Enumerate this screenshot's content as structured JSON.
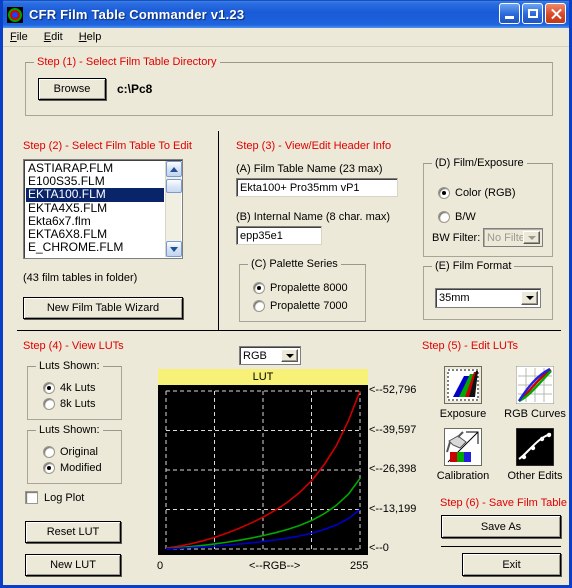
{
  "window": {
    "title": "CFR Film Table Commander v1.23",
    "app_icon": "rgb-ring-icon",
    "minimize": "minimize-icon",
    "maximize": "maximize-icon",
    "close": "close-icon"
  },
  "menu": [
    {
      "label": "File",
      "accel": "F"
    },
    {
      "label": "Edit",
      "accel": "E"
    },
    {
      "label": "Help",
      "accel": "H"
    }
  ],
  "step1": {
    "legend": "Step (1) - Select Film Table Directory",
    "browse_label": "Browse",
    "directory": "c:\\Pc8"
  },
  "step2": {
    "title": "Step (2) - Select Film Table To Edit",
    "items": [
      "ASTIARAP.FLM",
      "E100S35.FLM",
      "EKTA100.FLM",
      "EKTA4X5.FLM",
      "Ekta6x7.flm",
      "EKTA6X8.FLM",
      "E_CHROME.FLM"
    ],
    "selected_index": 2,
    "count_text": "(43 film tables in folder)",
    "wizard_label": "New Film Table Wizard"
  },
  "step3": {
    "title": "Step (3) - View/Edit Header Info",
    "a_label": "(A) Film Table Name (23 max)",
    "a_value": "Ekta100+ Pro35mm vP1",
    "b_label": "(B) Internal Name (8 char. max)",
    "b_value": "epp35e1",
    "c_legend": "(C) Palette Series",
    "c_options": [
      "Propalette 8000",
      "Propalette 7000"
    ],
    "c_selected": 0,
    "d_legend": "(D) Film/Exposure",
    "d_options": [
      "Color (RGB)",
      "B/W"
    ],
    "d_selected": 0,
    "bw_filter_label": "BW Filter:",
    "bw_filter_value": "No Filter",
    "e_legend": "(E) Film Format",
    "e_value": "35mm"
  },
  "step4": {
    "title": "Step (4) - View LUTs",
    "g1_legend": "Luts Shown:",
    "g1_options": [
      "4k Luts",
      "8k Luts"
    ],
    "g1_selected": 0,
    "g2_legend": "Luts Shown:",
    "g2_options": [
      "Original",
      "Modified"
    ],
    "g2_selected": 1,
    "log_plot_label": "Log Plot",
    "log_plot_checked": false,
    "reset_label": "Reset LUT",
    "new_label": "New LUT",
    "channel_select_value": "RGB"
  },
  "step5": {
    "title": "Step (5) - Edit LUTs",
    "buttons": [
      {
        "label": "Exposure",
        "icon": "exposure-gradient-icon"
      },
      {
        "label": "RGB Curves",
        "icon": "rgb-curves-icon"
      },
      {
        "label": "Calibration",
        "icon": "calibration-icon"
      },
      {
        "label": "Other Edits",
        "icon": "other-edits-icon"
      }
    ]
  },
  "step6": {
    "title": "Step (6) - Save Film Table",
    "save_label": "Save As",
    "exit_label": "Exit"
  },
  "colors": {
    "red": "#cc0000",
    "green": "#00a800",
    "blue": "#0000cc",
    "plot_bg": "#000000",
    "chart_header": "#f7f177",
    "step_label": "#e00000",
    "face": "#ece9d8",
    "titlebar": "#1a5ad8"
  },
  "chart_data": {
    "type": "line",
    "title": "LUT",
    "xlabel": "<--RGB-->",
    "ylabel": "",
    "xlim": [
      0,
      255
    ],
    "ylim": [
      0,
      52796
    ],
    "xtick_labels": [
      "0",
      "255"
    ],
    "ytick_labels": [
      "<--0",
      "<--13,199",
      "<--26,398",
      "<--39,597",
      "<--52,796"
    ],
    "ytick_values": [
      0,
      13199,
      26398,
      39597,
      52796
    ],
    "grid": true,
    "grid_style": "dashed-white",
    "legend": "none",
    "x": [
      0,
      16,
      32,
      48,
      64,
      80,
      96,
      112,
      128,
      144,
      160,
      176,
      192,
      208,
      224,
      240,
      255
    ],
    "series": [
      {
        "name": "Red",
        "color": "#cc0000",
        "values": [
          300,
          900,
          1700,
          2700,
          3900,
          5300,
          6900,
          8700,
          10700,
          13000,
          15700,
          19000,
          23000,
          28200,
          34600,
          43000,
          52796
        ]
      },
      {
        "name": "Green",
        "color": "#00a800",
        "values": [
          150,
          420,
          780,
          1200,
          1700,
          2250,
          2900,
          3650,
          4500,
          5450,
          6550,
          7900,
          9600,
          11800,
          14600,
          18400,
          23600
        ]
      },
      {
        "name": "Blue",
        "color": "#0000cc",
        "values": [
          90,
          240,
          440,
          680,
          960,
          1280,
          1640,
          2050,
          2520,
          3050,
          3650,
          4380,
          5300,
          6500,
          8050,
          10200,
          13200
        ]
      }
    ]
  }
}
